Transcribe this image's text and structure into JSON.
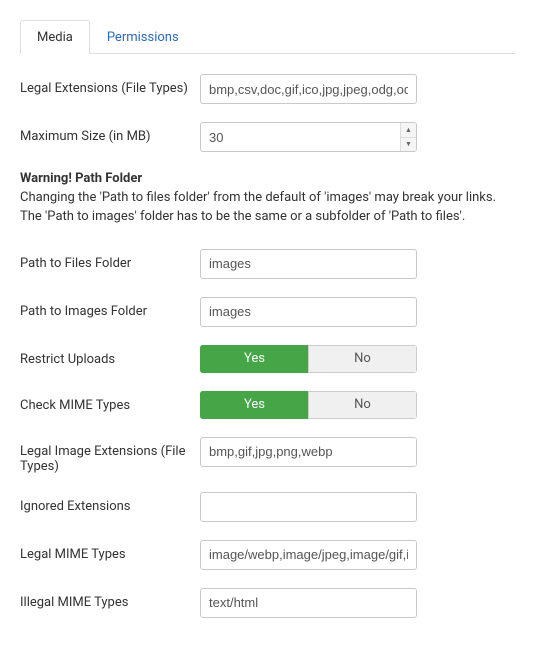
{
  "tabs": {
    "media": "Media",
    "permissions": "Permissions",
    "active": "media"
  },
  "fields": {
    "legal_ext_label": "Legal Extensions (File Types)",
    "legal_ext_value": "bmp,csv,doc,gif,ico,jpg,jpeg,odg,odp",
    "max_size_label": "Maximum Size (in MB)",
    "max_size_value": "30",
    "warn_title": "Warning! Path Folder",
    "warn_body1": "Changing the 'Path to files folder' from the default of 'images' may break your links.",
    "warn_body2": "The 'Path to images' folder has to be the same or a subfolder of 'Path to files'.",
    "path_files_label": "Path to Files Folder",
    "path_files_value": "images",
    "path_images_label": "Path to Images Folder",
    "path_images_value": "images",
    "restrict_label": "Restrict Uploads",
    "mime_label": "Check MIME Types",
    "yes": "Yes",
    "no": "No",
    "legal_img_label": "Legal Image Extensions (File Types)",
    "legal_img_value": "bmp,gif,jpg,png,webp",
    "ignored_label": "Ignored Extensions",
    "ignored_value": "",
    "legal_mime_label": "Legal MIME Types",
    "legal_mime_value": "image/webp,image/jpeg,image/gif,im",
    "illegal_mime_label": "Illegal MIME Types",
    "illegal_mime_value": "text/html"
  }
}
